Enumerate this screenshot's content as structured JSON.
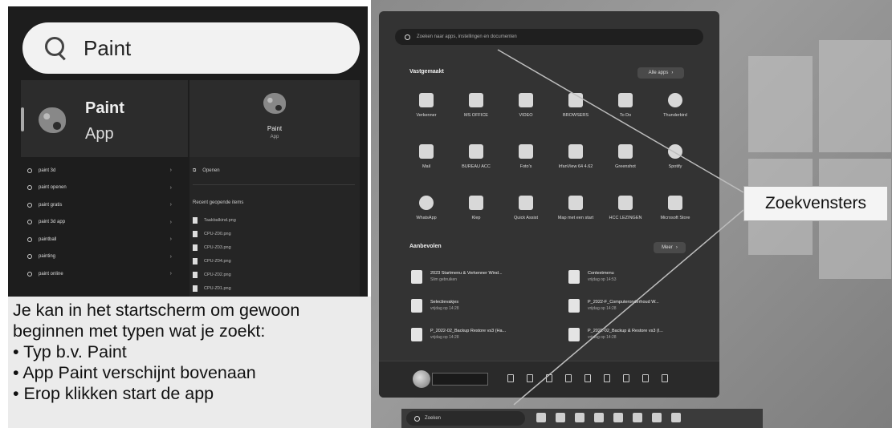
{
  "search_panel": {
    "query": "Paint",
    "best_match": {
      "name": "Paint",
      "type": "App"
    },
    "suggestions": [
      {
        "label": "paint 3d"
      },
      {
        "label": "paint openen"
      },
      {
        "label": "paint gratis"
      },
      {
        "label": "paint 3d app"
      },
      {
        "label": "paintball"
      },
      {
        "label": "painting"
      },
      {
        "label": "paint online"
      }
    ],
    "detail": {
      "name": "Paint",
      "type": "App",
      "open_label": "Openen",
      "recent_header": "Recent geopende items",
      "recent_files": [
        "Taakbalkind.png",
        "CPU-Z00.png",
        "CPU-Z03.png",
        "CPU-Z04.png",
        "CPU-Z02.png",
        "CPU-Z01.png"
      ]
    }
  },
  "caption": {
    "lines": [
      "Je kan in het startscherm om gewoon",
      "beginnen met typen wat je zoekt:",
      "• Typ b.v. Paint",
      "• App Paint verschijnt bovenaan",
      "• Erop klikken start de app"
    ]
  },
  "start_menu": {
    "search_placeholder": "Zoeken naar apps, instellingen en documenten",
    "pinned_header": "Vastgemaakt",
    "all_apps_label": "Alle apps",
    "pinned_apps": [
      {
        "label": "Verkenner",
        "icon": "folder-icon"
      },
      {
        "label": "MS OFFICE",
        "icon": "office-icon"
      },
      {
        "label": "VIDEO",
        "icon": "video-icon"
      },
      {
        "label": "BROWSERS",
        "icon": "browser-icon"
      },
      {
        "label": "To Do",
        "icon": "todo-icon"
      },
      {
        "label": "Thunderbird",
        "icon": "thunderbird-icon"
      },
      {
        "label": "Mail",
        "icon": "mail-icon"
      },
      {
        "label": "BUREAU ACC",
        "icon": "bureau-icon"
      },
      {
        "label": "Foto's",
        "icon": "photos-icon"
      },
      {
        "label": "IrfanView 64 4.62",
        "icon": "irfanview-icon"
      },
      {
        "label": "Greenshot",
        "icon": "greenshot-icon"
      },
      {
        "label": "Spotify",
        "icon": "spotify-icon"
      },
      {
        "label": "WhatsApp",
        "icon": "whatsapp-icon"
      },
      {
        "label": "Klep",
        "icon": "klep-icon"
      },
      {
        "label": "Quick Assist",
        "icon": "quick-assist-icon"
      },
      {
        "label": "Map met een start",
        "icon": "folder-icon"
      },
      {
        "label": "HCC LEZINGEN",
        "icon": "folder-icon"
      },
      {
        "label": "Microsoft Store",
        "icon": "store-icon"
      }
    ],
    "recommended_header": "Aanbevolen",
    "more_label": "Meer",
    "recommended": [
      {
        "title": "2023 Startmenu & Verkenner Wind...",
        "sub": "Slim gebruiken"
      },
      {
        "title": "Contextmenu",
        "sub": "vrijdag op 14:53"
      },
      {
        "title": "Selectievakjes",
        "sub": "vrijdag op 14:28"
      },
      {
        "title": "P_2022-F_Computeronderhoud W...",
        "sub": "vrijdag op 14:28"
      },
      {
        "title": "P_2022-02_Backup Restore vs3 (Ha...",
        "sub": "vrijdag op 14:28"
      },
      {
        "title": "P_2022-02_Backup & Restore vs3 (I...",
        "sub": "vrijdag op 14:28"
      }
    ]
  },
  "taskbar": {
    "search_label": "Zoeken"
  },
  "annotation": {
    "label": "Zoekvensters"
  }
}
